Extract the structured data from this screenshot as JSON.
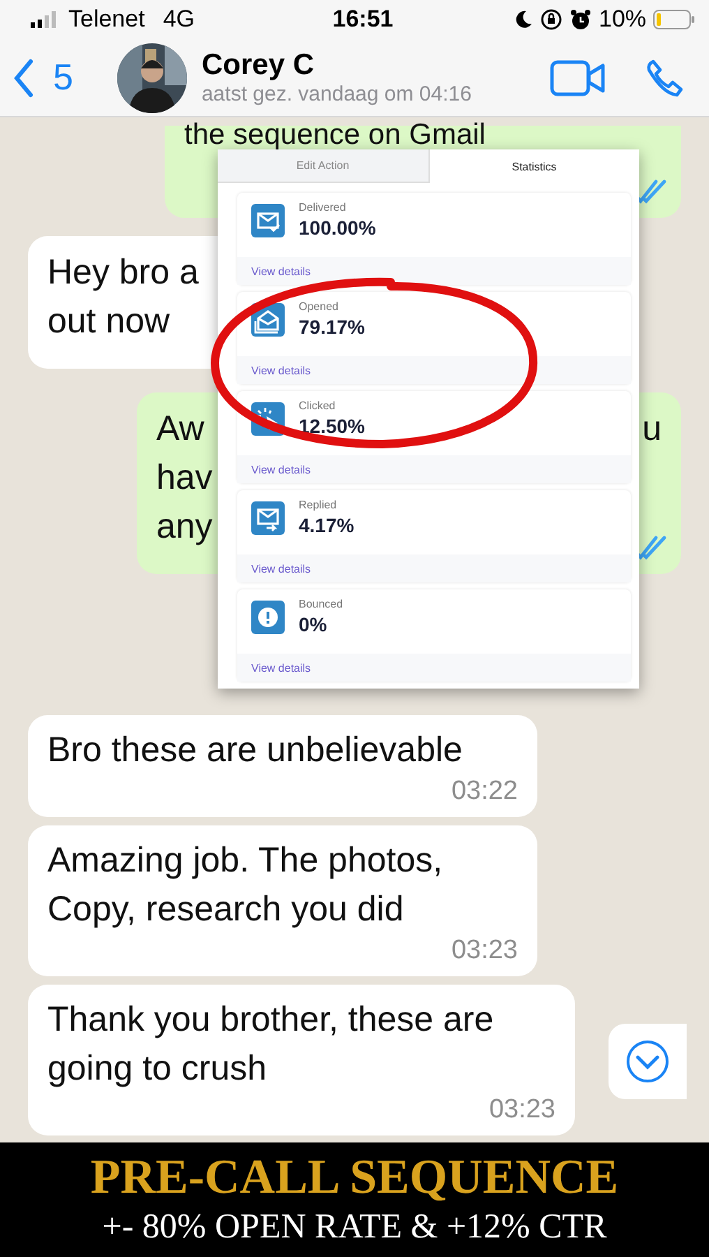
{
  "status_bar": {
    "carrier": "Telenet",
    "network": "4G",
    "time": "16:51",
    "battery": "10%"
  },
  "header": {
    "back_count": "5",
    "name": "Corey C",
    "last_seen": "aatst gez. vandaag om 04:16"
  },
  "messages": [
    {
      "kind": "outgoing",
      "lines": [
        "the sequence on Gmail"
      ],
      "read": true
    },
    {
      "kind": "incoming",
      "lines": [
        "Hey bro a",
        "out now"
      ]
    },
    {
      "kind": "outgoing",
      "lines": [
        "Aw",
        "hav",
        "any"
      ],
      "end_text": "u",
      "read": true
    },
    {
      "kind": "incoming",
      "lines": [
        "Bro these are unbelievable"
      ],
      "time": "03:22"
    },
    {
      "kind": "incoming",
      "lines": [
        "Amazing job. The photos,",
        "Copy, research you did"
      ],
      "time": "03:23"
    },
    {
      "kind": "incoming",
      "lines": [
        "Thank you brother, these are",
        "going to crush"
      ],
      "time": "03:23"
    }
  ],
  "stats_panel": {
    "tabs": [
      {
        "label": "Edit Action",
        "selected": false
      },
      {
        "label": "Statistics",
        "selected": true
      }
    ],
    "cards": [
      {
        "kind": "delivered",
        "label": "Delivered",
        "value": "100.00%",
        "link": "View details"
      },
      {
        "kind": "opened",
        "label": "Opened",
        "value": "79.17%",
        "link": "View details"
      },
      {
        "kind": "clicked",
        "label": "Clicked",
        "value": "12.50%",
        "link": "View details"
      },
      {
        "kind": "replied",
        "label": "Replied",
        "value": "4.17%",
        "link": "View details"
      },
      {
        "kind": "bounced",
        "label": "Bounced",
        "value": "0%",
        "link": "View details"
      }
    ]
  },
  "banner": {
    "title": "PRE-CALL SEQUENCE",
    "subtitle": "+- 80% OPEN RATE & +12% CTR"
  }
}
